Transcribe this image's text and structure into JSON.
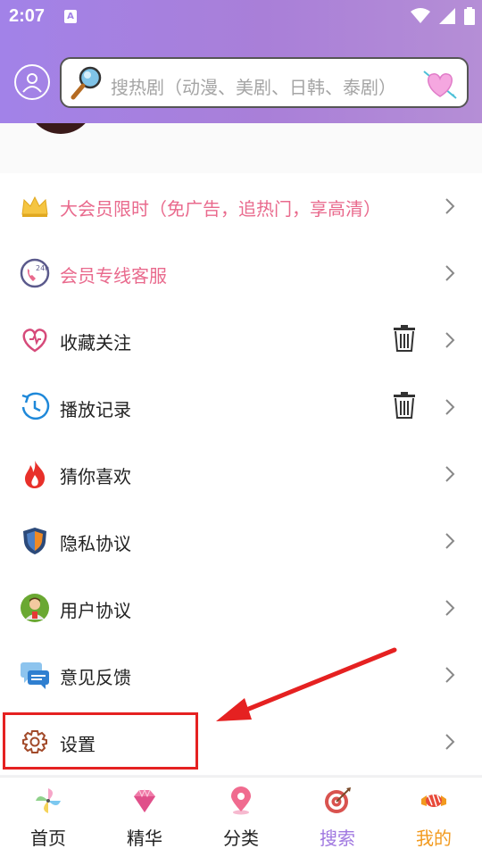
{
  "status_bar": {
    "time": "2:07",
    "notification_letter": "A"
  },
  "search": {
    "placeholder": "搜热剧（动漫、美剧、日韩、泰剧）"
  },
  "menu": {
    "items": [
      {
        "label": "大会员限时（免广告，追热门，享高清）",
        "icon": "crown-icon",
        "pink": true,
        "trash": false
      },
      {
        "label": "会员专线客服",
        "icon": "24h-service-icon",
        "pink": true,
        "trash": false
      },
      {
        "label": "收藏关注",
        "icon": "heart-outline-icon",
        "pink": false,
        "trash": true
      },
      {
        "label": "播放记录",
        "icon": "history-icon",
        "pink": false,
        "trash": true
      },
      {
        "label": "猜你喜欢",
        "icon": "flame-icon",
        "pink": false,
        "trash": false
      },
      {
        "label": "隐私协议",
        "icon": "shield-icon",
        "pink": false,
        "trash": false
      },
      {
        "label": "用户协议",
        "icon": "user-badge-icon",
        "pink": false,
        "trash": false
      },
      {
        "label": "意见反馈",
        "icon": "chat-bubbles-icon",
        "pink": false,
        "trash": false
      },
      {
        "label": "设置",
        "icon": "gear-icon",
        "pink": false,
        "trash": false
      }
    ]
  },
  "tabbar": {
    "tabs": [
      {
        "label": "首页",
        "icon": "pinwheel-icon",
        "color": "#222222"
      },
      {
        "label": "精华",
        "icon": "diamond-icon",
        "color": "#222222"
      },
      {
        "label": "分类",
        "icon": "map-pin-icon",
        "color": "#222222"
      },
      {
        "label": "搜索",
        "icon": "target-icon",
        "color": "#a078e0"
      },
      {
        "label": "我的",
        "icon": "candy-icon",
        "color": "#f29a1f"
      }
    ]
  },
  "colors": {
    "header_start": "#a282e8",
    "header_end": "#b58ed6",
    "pink_text": "#e96a8d",
    "annotation_red": "#e52121"
  }
}
